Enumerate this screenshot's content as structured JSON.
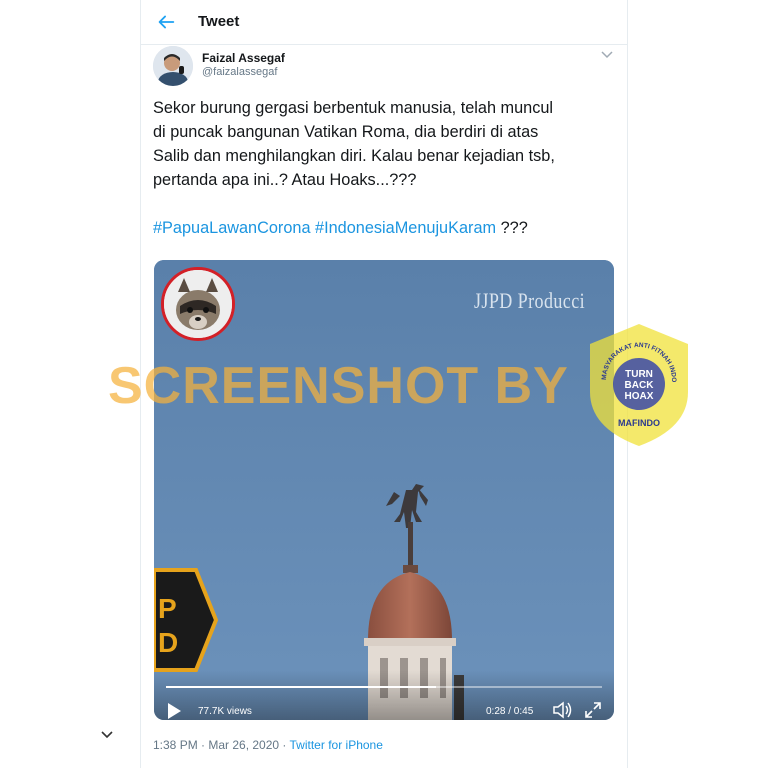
{
  "header": {
    "title": "Tweet"
  },
  "tweet": {
    "author_name": "Faizal Assegaf",
    "author_handle": "@faizalassegaf",
    "text_lines": [
      "Sekor burung gergasi berbentuk manusia, telah muncul",
      "di puncak bangunan Vatikan Roma, dia berdiri di atas",
      "Salib dan menghilangkan diri. Kalau benar kejadian tsb,",
      "pertanda apa ini..? Atau Hoaks...???"
    ],
    "hashtags": [
      "#PapuaLawanCorona",
      "#IndonesiaMenujuKaram"
    ],
    "hashtag_suffix": "???",
    "timestamp": "1:38 PM · Mar 26, 2020 · ",
    "source": "Twitter for iPhone"
  },
  "video": {
    "producer_text": "JJPD Producci",
    "views": "77.7K views",
    "time": "0:28 / 0:45",
    "progress": 0.62
  },
  "overlay": {
    "watermark": "SCREENSHOT BY",
    "badge_top_text": "MASYARAKAT ANTI FITNAH INDONESIA",
    "badge_center_1": "TURN",
    "badge_center_2": "BACK",
    "badge_center_3": "HOAX",
    "badge_bottom": "MAFINDO"
  },
  "colors": {
    "link": "#1b95e0",
    "watermark": "#f5b23c",
    "badge": "#f0e23a"
  },
  "icons": [
    "back-arrow-icon",
    "chevron-down-icon",
    "play-icon",
    "volume-icon",
    "fullscreen-icon"
  ]
}
